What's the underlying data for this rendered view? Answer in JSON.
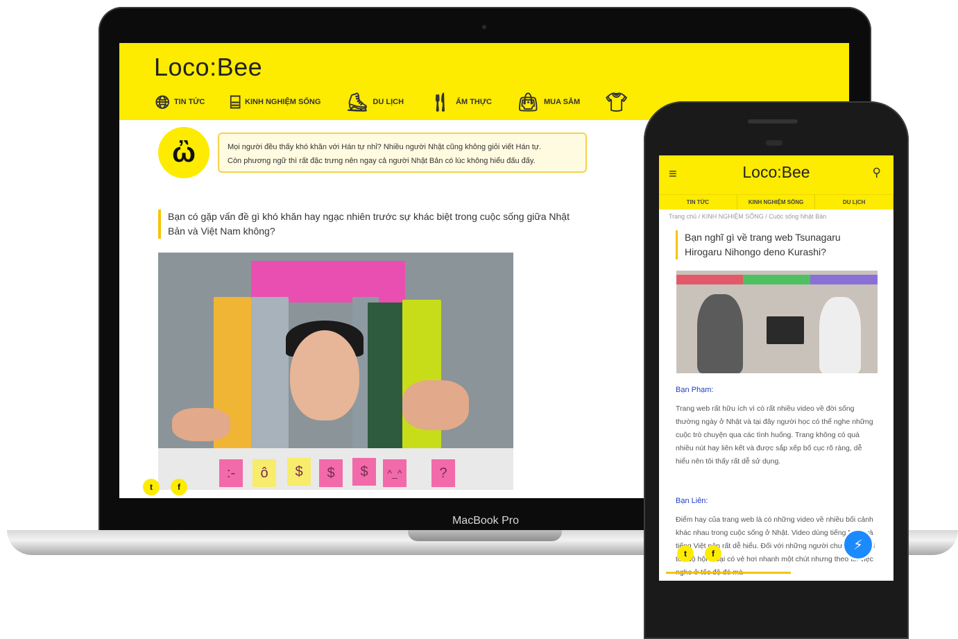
{
  "laptop": {
    "device_label": "MacBook Pro",
    "site": {
      "logo": "Loco:Bee",
      "nav": [
        {
          "label": "TIN TỨC",
          "icon": "globe-icon"
        },
        {
          "label": "KINH NGHIỆM SỐNG",
          "icon": "stairs-icon"
        },
        {
          "label": "DU LỊCH",
          "icon": "shoe-icon"
        },
        {
          "label": "ẨM THỰC",
          "icon": "cutlery-icon"
        },
        {
          "label": "MUA SẮM",
          "icon": "shopping-bag-icon"
        }
      ],
      "mascot_face": "ὢ",
      "bubble_line1": "Mọi người đều thấy khó khăn với Hán tự nhỉ? Nhiều người Nhật cũng không giỏi viết Hán tự.",
      "bubble_line2": "Còn phương ngữ thì rất đặc trưng nên ngay cả người Nhật Bản có lúc không hiểu đấu đấy.",
      "question": "Bạn có gặp vấn đề gì khó khăn hay ngạc nhiên trước sự khác biệt trong cuộc sống giữa Nhật Bản và Việt Nam không?",
      "share_twitter": "t",
      "share_facebook": "f",
      "sticky_notes": [
        ":-",
        "ô",
        "$",
        "$",
        "$",
        "^_^",
        "?"
      ]
    }
  },
  "phone": {
    "site": {
      "logo": "Loco:Bee",
      "menu_icon": "≡",
      "search_icon": "⚲",
      "tabs": [
        "TIN TỨC",
        "KINH NGHIỆM SỐNG",
        "DU LỊCH"
      ],
      "breadcrumb": "Trang chủ / KINH NGHIỆM SỐNG / Cuộc sống Nhật Bản",
      "title": "Bạn nghĩ gì về trang web Tsunagaru Hirogaru Nihongo deno Kurashi?",
      "comments": [
        {
          "name": "Bạn Phạm:",
          "text": "Trang web rất hữu ích vì có rất nhiều video về đời sống thường ngày ở Nhật và tại đây người học có thể nghe những cuộc trò chuyện qua các tình huống. Trang không có quá nhiều nút hay liên kết và được sắp xếp bố cục rõ ràng, dễ hiểu nên tôi thấy rất dễ sử dụng."
        },
        {
          "name": "Bạn Liên:",
          "text": "Điểm hay của trang web là có những video về nhiều bối cảnh khác nhau trong cuộc sống ở Nhật. Video dùng tiếng Nhật và tiếng Việt nên rất dễ hiểu. Đối với những người chưa quen thì tốc độ hội thoại có vẻ hơi nhanh một chút nhưng theo tôi việc nghe ở tốc độ đó mà"
        }
      ],
      "share_twitter": "t",
      "share_facebook": "f",
      "messenger_icon": "⚡"
    }
  },
  "colors": {
    "brand_yellow": "#fdeb00",
    "accent_gold": "#f4c400",
    "link_blue": "#1d3fc8",
    "messenger_blue": "#1b8aff"
  }
}
